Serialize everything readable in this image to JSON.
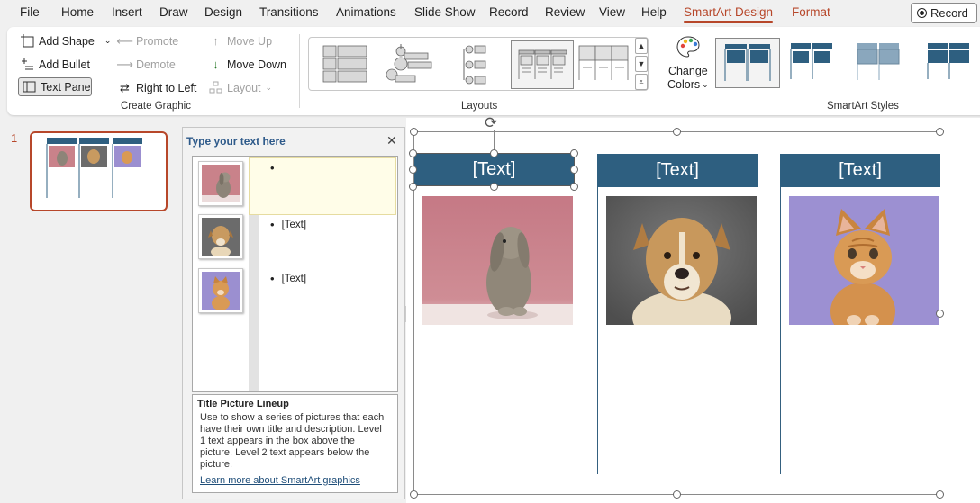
{
  "menu": {
    "items": [
      "File",
      "Home",
      "Insert",
      "Draw",
      "Design",
      "Transitions",
      "Animations",
      "Slide Show",
      "Record",
      "Review",
      "View",
      "Help",
      "SmartArt Design",
      "Format"
    ],
    "active": "SmartArt Design",
    "record_button": "Record"
  },
  "ribbon": {
    "create_graphic": {
      "label": "Create Graphic",
      "add_shape": "Add Shape",
      "add_bullet": "Add Bullet",
      "text_pane": "Text Pane",
      "promote": "Promote",
      "demote": "Demote",
      "right_to_left": "Right to Left",
      "move_up": "Move Up",
      "move_down": "Move Down",
      "layout": "Layout"
    },
    "layouts": {
      "label": "Layouts"
    },
    "smartart_styles": {
      "label": "SmartArt Styles",
      "change_colors_line1": "Change",
      "change_colors_line2": "Colors"
    }
  },
  "slides_panel": {
    "slide_number": "1"
  },
  "text_pane": {
    "title": "Type your text here",
    "items": [
      "",
      "[Text]",
      "[Text]"
    ],
    "desc_title": "Title Picture Lineup",
    "desc_body": "Use to show a series of pictures that each have their own title and description. Level 1 text appears in the box above the picture. Level 2 text appears below the picture.",
    "desc_link": "Learn more about SmartArt graphics"
  },
  "smartart": {
    "titles": [
      "[Text]",
      "[Text]",
      "[Text]"
    ],
    "pictures": [
      "rabbit",
      "dog",
      "kitten"
    ]
  },
  "colors": {
    "accent": "#b7472a",
    "title_box": "#2e5f80"
  }
}
